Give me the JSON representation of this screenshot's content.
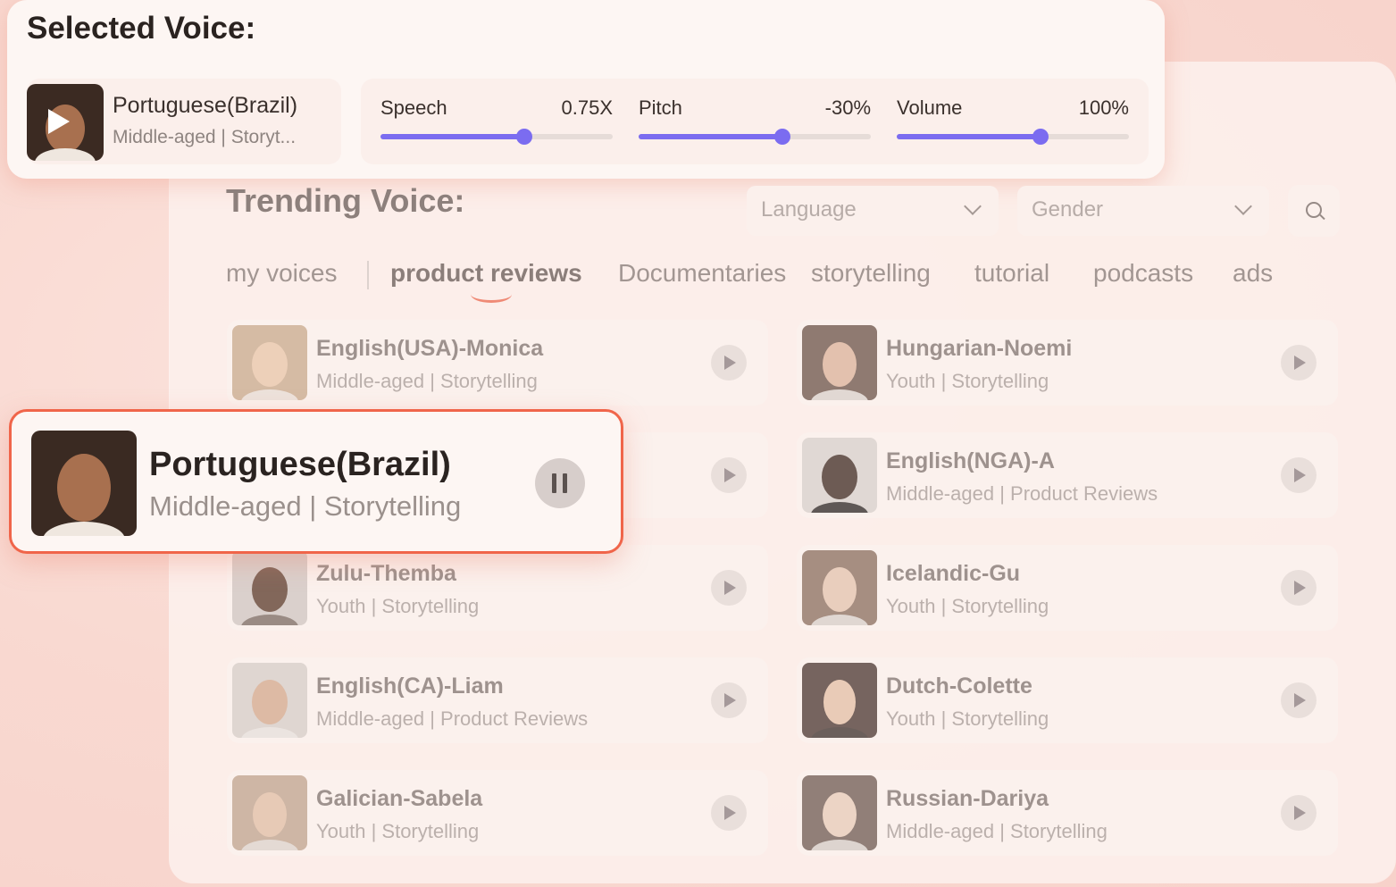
{
  "selected": {
    "title": "Selected Voice:",
    "voice_name": "Portuguese(Brazil)",
    "voice_meta": "Middle-aged | Storyt...",
    "sliders": [
      {
        "label": "Speech",
        "value": "0.75X",
        "level": 0.62
      },
      {
        "label": "Pitch",
        "value": "-30%",
        "level": 0.62
      },
      {
        "label": "Volume",
        "value": "100%",
        "level": 0.62
      }
    ]
  },
  "trending": {
    "title": "Trending Voice:",
    "language_placeholder": "Language",
    "gender_placeholder": "Gender",
    "tabs": [
      "my voices",
      "product reviews",
      "Documentaries",
      "storytelling",
      "tutorial",
      "podcasts",
      "ads"
    ],
    "active_tab": "product reviews",
    "voices_left": [
      {
        "name": "English(USA)-Monica",
        "meta": "Middle-aged | Storytelling"
      },
      {
        "name": "",
        "meta": ""
      },
      {
        "name": "Zulu-Themba",
        "meta": "Youth | Storytelling"
      },
      {
        "name": "English(CA)-Liam",
        "meta": "Middle-aged | Product Reviews"
      },
      {
        "name": "Galician-Sabela",
        "meta": "Youth | Storytelling"
      }
    ],
    "voices_right": [
      {
        "name": "Hungarian-Noemi",
        "meta": "Youth | Storytelling"
      },
      {
        "name": "English(NGA)-A",
        "meta": "Middle-aged | Product Reviews"
      },
      {
        "name": "Icelandic-Gu",
        "meta": "Youth | Storytelling"
      },
      {
        "name": "Dutch-Colette",
        "meta": "Youth | Storytelling"
      },
      {
        "name": "Russian-Dariya",
        "meta": "Middle-aged | Storytelling"
      }
    ]
  },
  "highlight": {
    "name": "Portuguese(Brazil)",
    "meta": "Middle-aged | Storytelling"
  },
  "colors": {
    "accent": "#7b6cf0",
    "highlight_border": "#f0654a",
    "background": "#f9d9d1"
  }
}
